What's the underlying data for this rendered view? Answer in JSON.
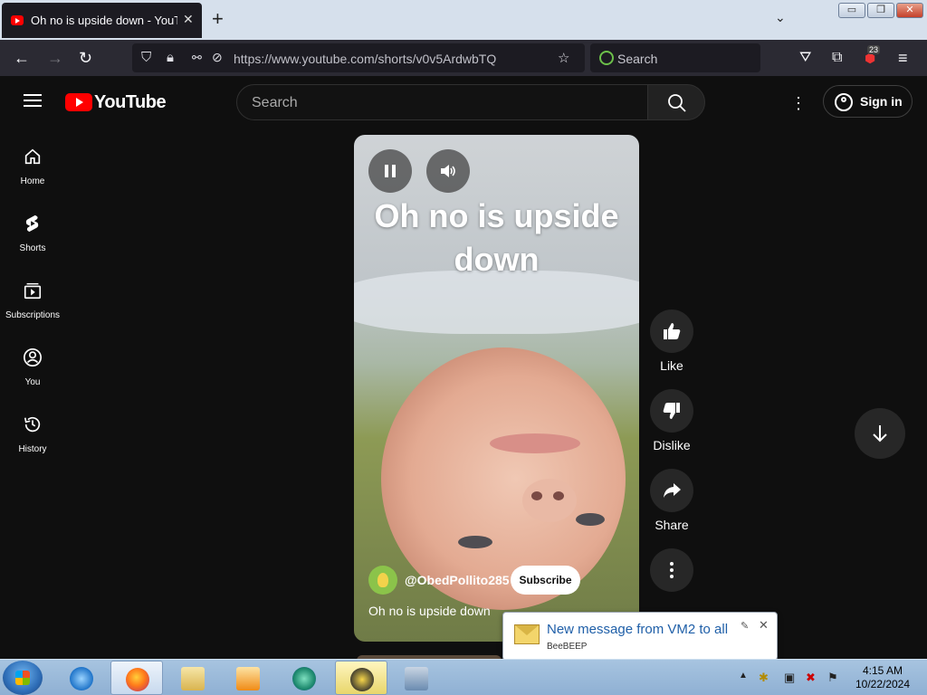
{
  "browser": {
    "tab_title": "Oh no is upside down - YouTube",
    "new_tab_label": "+",
    "url": "https://www.youtube.com/shorts/v0v5ArdwbTQ",
    "search_label": "Search",
    "extension_badge": "23"
  },
  "youtube": {
    "logo_text": "YouTube",
    "search_placeholder": "Search",
    "signin_label": "Sign in",
    "sidebar": [
      {
        "label": "Home",
        "icon": "home-icon"
      },
      {
        "label": "Shorts",
        "icon": "shorts-icon"
      },
      {
        "label": "Subscriptions",
        "icon": "subscriptions-icon"
      },
      {
        "label": "You",
        "icon": "you-icon"
      },
      {
        "label": "History",
        "icon": "history-icon"
      }
    ],
    "short": {
      "overlay_title": "Oh no is upside down",
      "channel": "@ObedPollito285",
      "subscribe_label": "Subscribe",
      "caption": "Oh no is upside down"
    },
    "actions": {
      "like_label": "Like",
      "dislike_label": "Dislike",
      "share_label": "Share"
    }
  },
  "notification": {
    "message": "New message from VM2 to all",
    "source": "BeeBEEP"
  },
  "taskbar": {
    "time": "4:15 AM",
    "date": "10/22/2024"
  },
  "colors": {
    "youtube_red": "#ff0000",
    "page_bg": "#0f0f0f",
    "firefox_chrome": "#2b2a33"
  }
}
